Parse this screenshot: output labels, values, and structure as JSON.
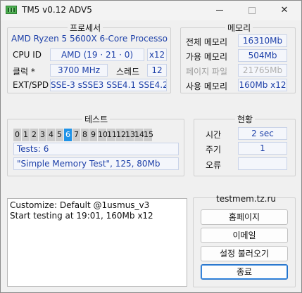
{
  "window": {
    "title": "TM5 v0.12 ADV5",
    "minimize_glyph": "minimize",
    "maximize_glyph": "maximize",
    "close_glyph": "✕"
  },
  "processor": {
    "title": "프로세서",
    "name": "AMD Ryzen 5 5600X 6-Core Processor",
    "cpu_id_label": "CPU ID",
    "cpu_id_value": "AMD  (19 · 21 · 0)",
    "cpu_id_mult": "x12",
    "clock_label": "클럭 *",
    "clock_value": "3700 MHz",
    "threads_label": "스레드",
    "threads_value": "12",
    "ext_label": "EXT/SPD",
    "ext_value": "SSE-3 sSSE3 SSE4.1 SSE4.2"
  },
  "memory": {
    "title": "메모리",
    "total_label": "전체 메모리",
    "total_value": "16310Mb",
    "avail_label": "가용 메모리",
    "avail_value": "504Mb",
    "page_label": "페이지 파일",
    "page_value": "21765Mb",
    "used_label": "사용 메모리",
    "used_value": "160Mb x12"
  },
  "test": {
    "title": "테스트",
    "tiles": [
      "0",
      "1",
      "2",
      "3",
      "4",
      "5",
      "6",
      "7",
      "8",
      "9",
      "10",
      "11",
      "12",
      "13",
      "14",
      "15"
    ],
    "active_tile": "6",
    "tests_line": "Tests: 6",
    "status_line": "\"Simple Memory Test\", 125, 80Mb"
  },
  "status": {
    "title": "현황",
    "time_label": "시간",
    "time_value": "2 sec",
    "cycle_label": "주기",
    "cycle_value": "1",
    "error_label": "오류",
    "error_value": ""
  },
  "log": {
    "lines": [
      "Customize: Default @1usmus_v3",
      "Start testing at 19:01, 160Mb x12"
    ]
  },
  "side": {
    "site": "testmem.tz.ru",
    "home_button": "홈페이지",
    "email_button": "이메일",
    "load_button": "설정 불러오기",
    "exit_button": "종료"
  },
  "colors": {
    "value_text": "#1c3fa8",
    "active_tile": "#1f93e8",
    "tile": "#cccccc"
  }
}
